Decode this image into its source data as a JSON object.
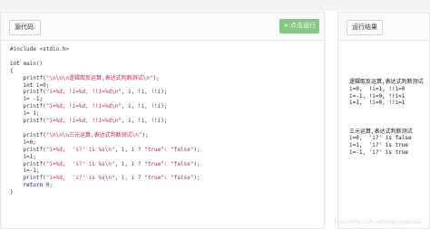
{
  "editor": {
    "tab_label": "源代码:",
    "run_button_label": "点击运行",
    "run_icon": "send-icon",
    "code_lines": [
      "#include <stdio.h>",
      "",
      "int main()",
      "{",
      "    printf(\"\\n\\n\\n逻辑取反运算,表达式判断测试\\n\");",
      "    int i=0;",
      "    printf(\"i=%d, !i=%d, !!i=%d\\n\", i, !i, !!i);",
      "    i= -1;",
      "    printf(\"i=%d, !i=%d, !!i=%d\\n\", i, !i, !!i);",
      "    i= 1;",
      "    printf(\"i=%d, !i=%d, !!i=%d\\n\", i, !i, !!i);",
      "",
      "    printf(\"\\n\\n\\n三元运算,表达式判断测试\\n\");",
      "    i=0;",
      "    printf(\"i=%d,  'i?' is %s\\n\", i, i ? \"true\": \"false\");",
      "    i=1;",
      "    printf(\"i=%d,  'i?' is %s\\n\", i, i ? \"true\": \"false\");",
      "    i=-1;",
      "    printf(\"i=%d,  'i?' is %s\\n\", i, i ? \"true\": \"false\");",
      "    return 0;",
      "}"
    ]
  },
  "results": {
    "tab_label": "运行结果",
    "output_lines": [
      "逻辑取反运算,表达式判断测试",
      "i=0,  !i=1, !!i=0",
      "i=-1, !i=0, !!i=1",
      "i=1,  !i=0, !!i=1",
      "",
      "",
      "",
      "三元运算,表达式判断测试",
      "i=0,  'i?' is false",
      "i=1,  'i?' is true",
      "i=-1, 'i?' is true"
    ]
  },
  "watermark": "https://blog.csdn.net/qinghongjunjian"
}
